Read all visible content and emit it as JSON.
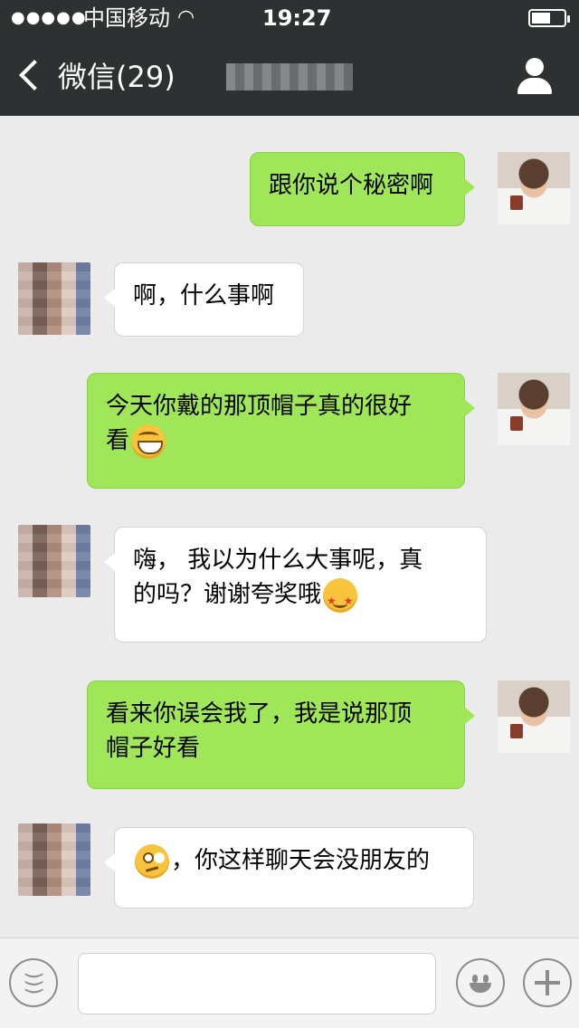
{
  "status": {
    "signal": "●●●●●",
    "carrier": "中国移动",
    "time": "19:27"
  },
  "nav": {
    "back_label": "微信(29)"
  },
  "messages": [
    {
      "from": "me",
      "text": "跟你说个秘密啊"
    },
    {
      "from": "other",
      "text": "啊，什么事啊"
    },
    {
      "from": "me",
      "text_line1": "今天你戴的那顶帽子真的很好",
      "text_line2": "看",
      "emoji": "grin"
    },
    {
      "from": "other",
      "text_line1": "嗨， 我以为什么大事呢，真",
      "text_line2": "的吗？谢谢夸奖哦",
      "emoji": "star-eyes"
    },
    {
      "from": "me",
      "text_line1": "看来你误会我了，我是说那顶",
      "text_line2": "帽子好看"
    },
    {
      "from": "other",
      "emoji": "eye-roll",
      "text": "，你这样聊天会没朋友的"
    }
  ],
  "colors": {
    "top_bar": "#2e3132",
    "my_bubble": "#9fe658",
    "chat_bg": "#ebebeb"
  }
}
